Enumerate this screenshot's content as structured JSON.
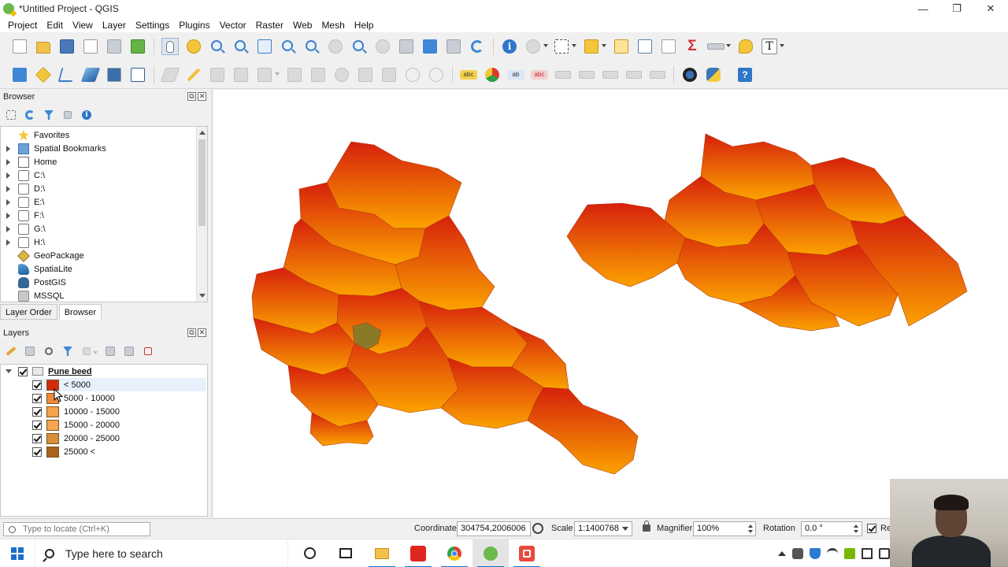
{
  "window": {
    "title": "*Untitled Project - QGIS",
    "controls": {
      "minimize": "—",
      "restore": "❐",
      "close": "✕"
    }
  },
  "menubar": {
    "items": [
      "Project",
      "Edit",
      "View",
      "Layer",
      "Settings",
      "Plugins",
      "Vector",
      "Raster",
      "Web",
      "Mesh",
      "Help"
    ]
  },
  "toolbar1": {
    "icons": [
      "new-project-icon",
      "open-project-icon",
      "save-project-icon",
      "new-print-layout-icon",
      "show-layout-manager-icon",
      "style-manager-icon",
      "pan-map-icon",
      "pan-to-selection-icon",
      "zoom-in-icon",
      "zoom-out-icon",
      "zoom-full-icon",
      "zoom-to-selection-icon",
      "zoom-to-layer-icon",
      "zoom-native-icon",
      "zoom-last-icon",
      "zoom-next-icon",
      "new-map-view-icon",
      "temporal-controller-icon",
      "new-bookmark-icon",
      "show-bookmarks-icon",
      "refresh-icon",
      "identify-features-icon",
      "actions-icon",
      "select-features-icon",
      "open-attribute-table-icon",
      "deselect-features-icon",
      "attribute-table-icon",
      "field-calculator-icon",
      "statistics-summary-icon",
      "measure-line-icon",
      "map-tips-icon",
      "text-annotation-icon"
    ]
  },
  "toolbar2": {
    "icons": [
      "data-source-manager-icon",
      "new-geopackage-layer-icon",
      "new-shapefile-layer-icon",
      "new-spatialite-layer-icon",
      "new-temporary-layer-icon",
      "new-virtual-layer-icon",
      "current-edits-icon",
      "toggle-editing-icon",
      "save-layer-edits-icon",
      "add-polygon-feature-icon",
      "vertex-tool-icon",
      "modify-attributes-icon",
      "delete-selected-icon",
      "cut-features-icon",
      "copy-features-icon",
      "paste-features-icon",
      "undo-icon",
      "redo-icon",
      "label-tool-icon",
      "diagram-tool-icon",
      "pin-labels-icon",
      "show-hide-labels-icon",
      "move-label-icon",
      "rotate-label-icon",
      "change-label-icon",
      "digitize-tool-icon",
      "advanced-digitize-icon",
      "osm-place-search-icon",
      "python-console-icon",
      "help-icon"
    ]
  },
  "browser_panel": {
    "title": "Browser",
    "items": [
      {
        "label": "Favorites",
        "icon": "favorites-star-icon",
        "expandable": false
      },
      {
        "label": "Spatial Bookmarks",
        "icon": "spatial-bookmarks-icon",
        "expandable": true
      },
      {
        "label": "Home",
        "icon": "home-folder-icon",
        "expandable": true
      },
      {
        "label": "C:\\",
        "icon": "drive-icon",
        "expandable": true
      },
      {
        "label": "D:\\",
        "icon": "drive-icon",
        "expandable": true
      },
      {
        "label": "E:\\",
        "icon": "drive-icon",
        "expandable": true
      },
      {
        "label": "F:\\",
        "icon": "drive-icon",
        "expandable": true
      },
      {
        "label": "G:\\",
        "icon": "drive-icon",
        "expandable": true
      },
      {
        "label": "H:\\",
        "icon": "drive-icon",
        "expandable": true
      },
      {
        "label": "GeoPackage",
        "icon": "geopackage-icon",
        "expandable": false
      },
      {
        "label": "SpatiaLite",
        "icon": "spatialite-icon",
        "expandable": false
      },
      {
        "label": "PostGIS",
        "icon": "postgis-icon",
        "expandable": false
      },
      {
        "label": "MSSQL",
        "icon": "mssql-icon",
        "expandable": false
      }
    ]
  },
  "tabs": [
    {
      "label": "Layer Order",
      "active": false
    },
    {
      "label": "Browser",
      "active": true
    }
  ],
  "layers_panel": {
    "title": "Layers",
    "layer": {
      "name": "Pune beed",
      "checked": true
    },
    "classes": [
      {
        "label": "< 5000",
        "color": "#d42a0e",
        "checked": true
      },
      {
        "label": "5000 - 10000",
        "color": "#f08a3a",
        "checked": true
      },
      {
        "label": "10000 - 15000",
        "color": "#f6a24e",
        "checked": true
      },
      {
        "label": "15000 - 20000",
        "color": "#f3a64f",
        "checked": true
      },
      {
        "label": "20000 - 25000",
        "color": "#d98e3c",
        "checked": true
      },
      {
        "label": "25000 <",
        "color": "#a8621a",
        "checked": true
      }
    ]
  },
  "map": {
    "fill_colors": {
      "top": "#d6200c",
      "bottom": "#fba300",
      "highlight": "#8a7a28"
    }
  },
  "statusbar": {
    "locator_placeholder": "Type to locate (Ctrl+K)",
    "coordinate_label": "Coordinate",
    "coordinate_value": "304754,2006006",
    "scale_label": "Scale",
    "scale_value": "1:1400768",
    "magnifier_label": "Magnifier",
    "magnifier_value": "100%",
    "rotation_label": "Rotation",
    "rotation_value": "0.0 °",
    "render_label": "Re"
  },
  "taskbar": {
    "search_placeholder": "Type here to search",
    "apps": [
      "cortana-icon",
      "task-view-icon",
      "file-explorer-icon",
      "acrobat-icon",
      "chrome-icon",
      "qgis-icon",
      "screen-recorder-icon"
    ]
  }
}
